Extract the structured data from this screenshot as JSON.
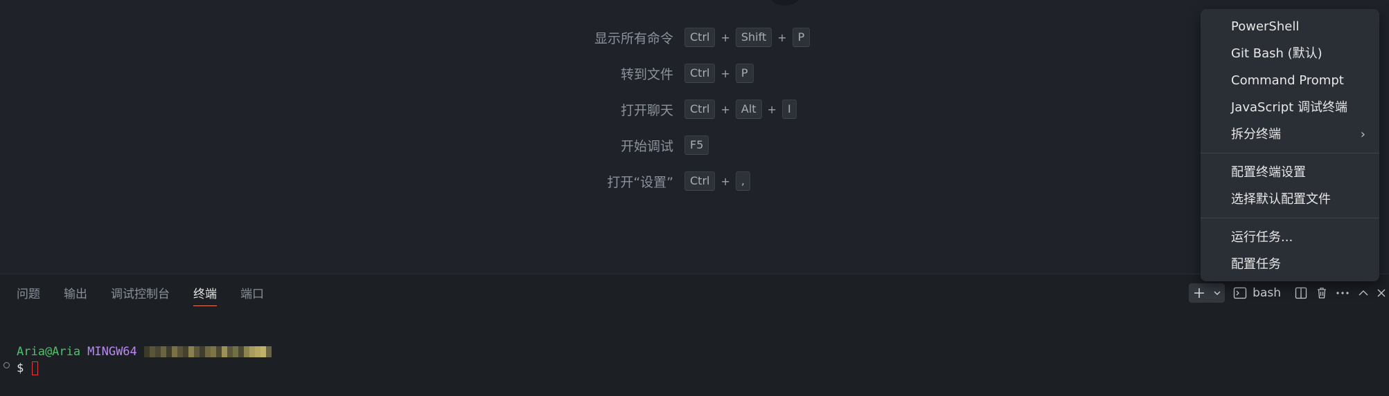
{
  "welcome": {
    "shortcuts": [
      {
        "label": "显示所有命令",
        "keys": [
          "Ctrl",
          "Shift",
          "P"
        ]
      },
      {
        "label": "转到文件",
        "keys": [
          "Ctrl",
          "P"
        ]
      },
      {
        "label": "打开聊天",
        "keys": [
          "Ctrl",
          "Alt",
          "I"
        ]
      },
      {
        "label": "开始调试",
        "keys": [
          "F5"
        ]
      },
      {
        "label": "打开“设置”",
        "keys": [
          "Ctrl",
          ","
        ]
      }
    ],
    "plus_sign": "+"
  },
  "panel": {
    "tabs": [
      {
        "label": "问题",
        "active": false
      },
      {
        "label": "输出",
        "active": false
      },
      {
        "label": "调试控制台",
        "active": false
      },
      {
        "label": "终端",
        "active": true
      },
      {
        "label": "端口",
        "active": false
      }
    ],
    "actions": {
      "add_icon": "plus-icon",
      "dropdown_icon": "chevron-down-icon",
      "profile_icon": "terminal-icon",
      "profile_label": "bash",
      "split_icon": "split-icon",
      "trash_icon": "trash-icon",
      "more_icon": "ellipsis-icon",
      "maximize_icon": "chevron-up-icon",
      "close_icon": "close-icon"
    },
    "terminal": {
      "user": "Aria@Aria",
      "host": "MINGW64",
      "prompt": "$",
      "path_redacted_colors": [
        "#3c3a2a",
        "#5a5536",
        "#4a4634",
        "#6a6440",
        "#3e3c2d",
        "#7a7246",
        "#585236",
        "#44412f",
        "#8a8150",
        "#5e583a",
        "#3f3d2e",
        "#6e6842",
        "#7d7447",
        "#4c4833",
        "#9c9258",
        "#5b5539",
        "#707046",
        "#4a4733",
        "#8c844f",
        "#a89d5e",
        "#b4a862",
        "#c0b267",
        "#6a6440"
      ],
      "accent_error": "#e23a3a"
    }
  },
  "menu": {
    "items": [
      {
        "label": "PowerShell",
        "chevron": false
      },
      {
        "label": "Git Bash (默认)",
        "chevron": false
      },
      {
        "label": "Command Prompt",
        "chevron": false
      },
      {
        "label": "JavaScript 调试终端",
        "chevron": false
      },
      {
        "label": "拆分终端",
        "chevron": true,
        "sep_after": true
      },
      {
        "label": "配置终端设置",
        "chevron": false
      },
      {
        "label": "选择默认配置文件",
        "chevron": false,
        "sep_after": true
      },
      {
        "label": "运行任务...",
        "chevron": false
      },
      {
        "label": "配置任务",
        "chevron": false
      }
    ],
    "chevron_glyph": "›"
  },
  "colors": {
    "editor_bg": "#1f2329",
    "panel_bg": "#1c1f24",
    "menu_bg": "#2a2e35",
    "active_tab_underline": "#f0794f",
    "prompt_user": "#4ec16a",
    "prompt_host": "#b98bf0"
  }
}
